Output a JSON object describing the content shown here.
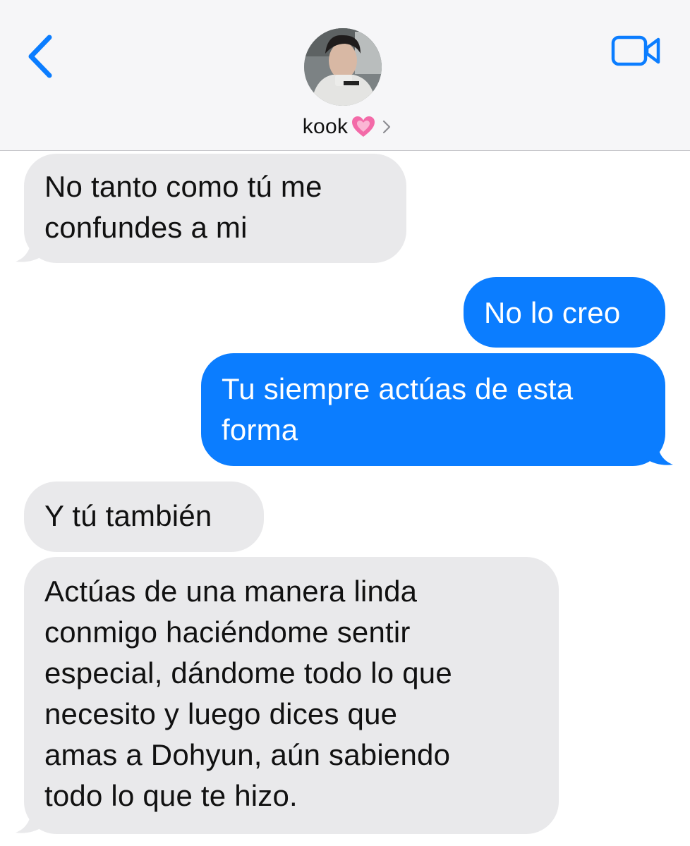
{
  "header": {
    "contact_name": "kook",
    "back_icon": "chevron-left-icon",
    "video_icon": "video-camera-icon",
    "heart_icon": "growing-heart-emoji",
    "accent_color": "#0b7dff"
  },
  "messages": [
    {
      "direction": "incoming",
      "lines": [
        "No tanto como tú me",
        "confundes a mi"
      ]
    },
    {
      "direction": "outgoing",
      "lines": [
        "No lo creo"
      ]
    },
    {
      "direction": "outgoing",
      "lines": [
        "Tu siempre actúas de esta",
        "forma"
      ]
    },
    {
      "direction": "incoming",
      "lines": [
        "Y tú también"
      ]
    },
    {
      "direction": "incoming",
      "lines": [
        "Actúas de una manera linda",
        "conmigo haciéndome sentir",
        "especial, dándome todo lo que",
        "necesito y luego dices que",
        "amas a Dohyun, aún sabiendo",
        "todo lo que te hizo."
      ]
    }
  ],
  "colors": {
    "incoming_bubble": "#e9e9eb",
    "outgoing_bubble": "#0b7dff",
    "header_bg": "#f6f6f8"
  }
}
